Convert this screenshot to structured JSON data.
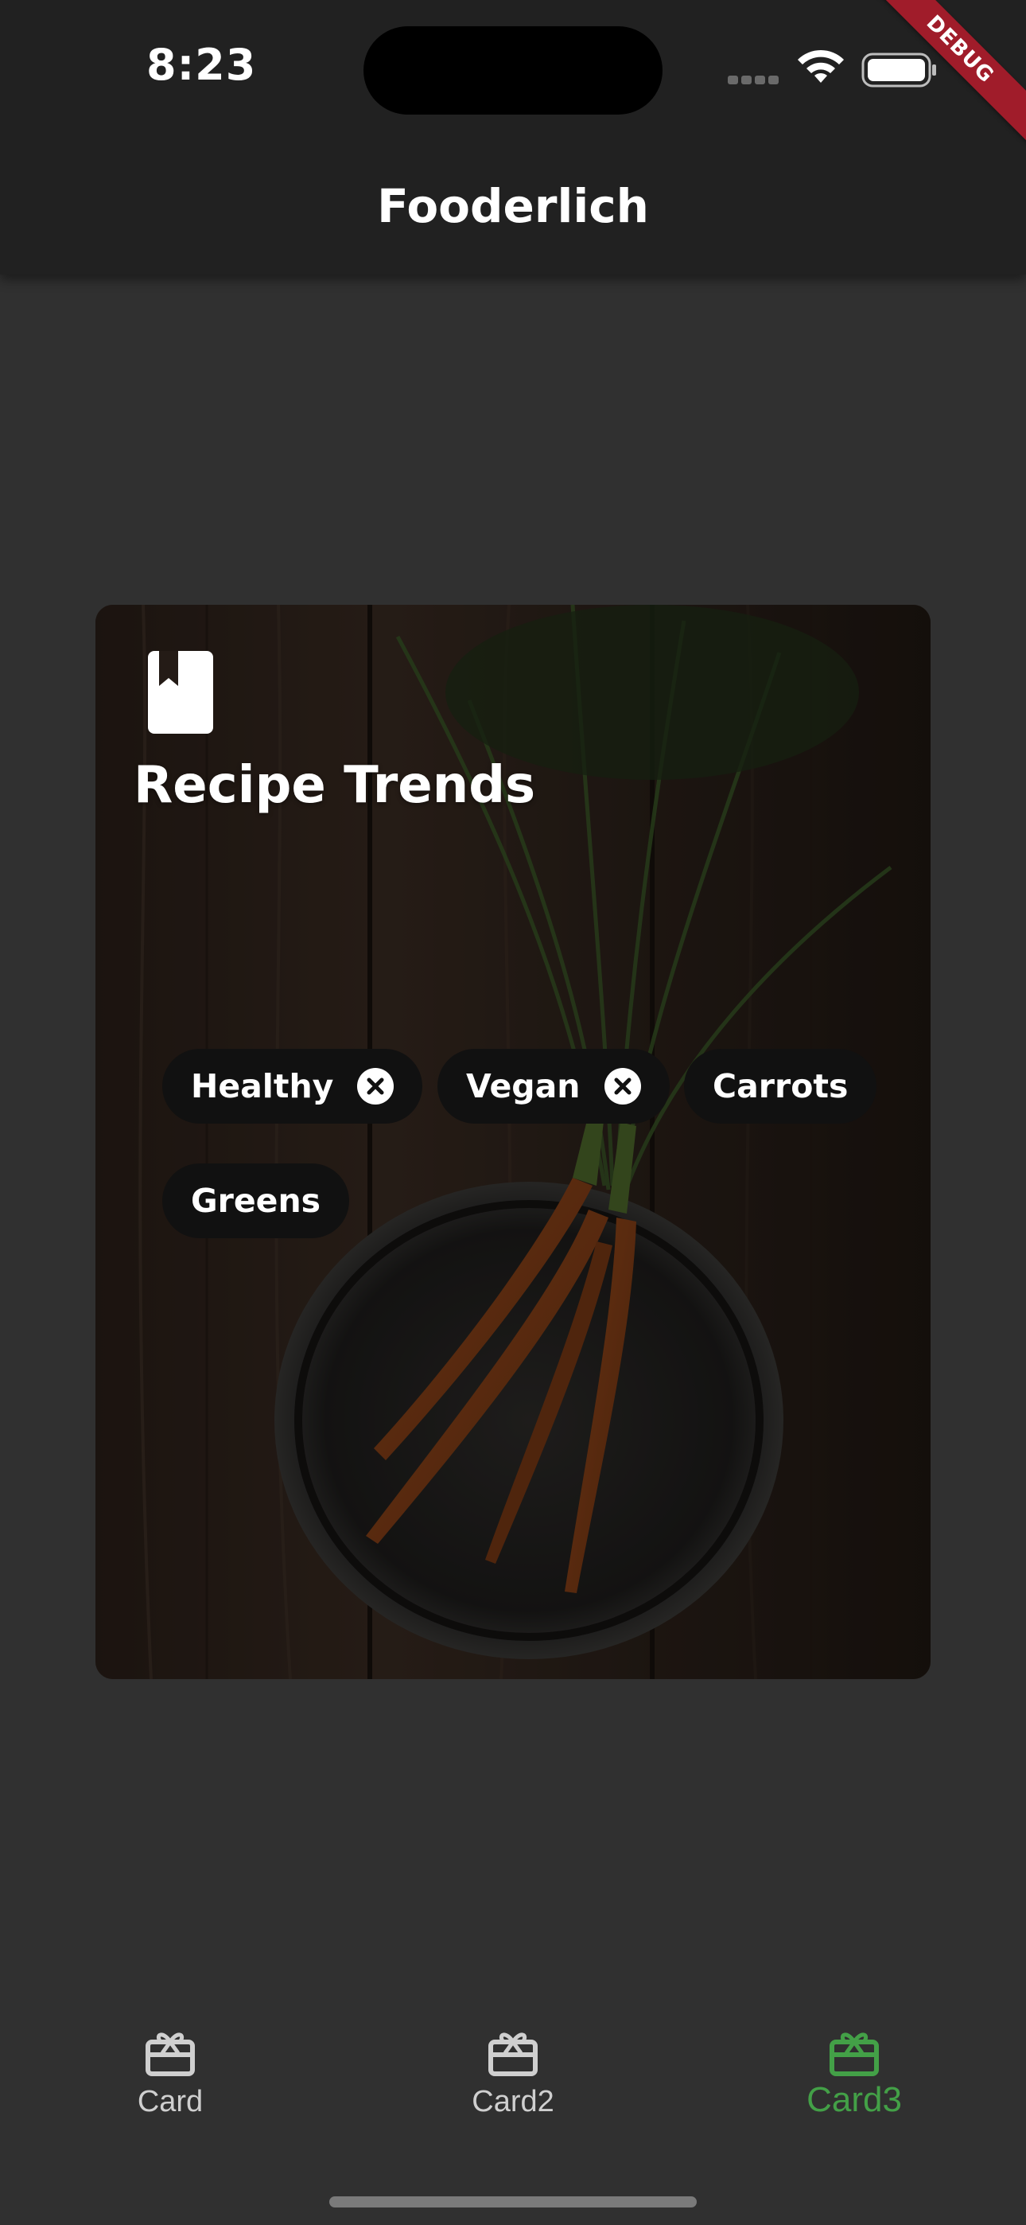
{
  "status_bar": {
    "time": "8:23",
    "debug_banner": "DEBUG"
  },
  "app_bar": {
    "title": "Fooderlich"
  },
  "card": {
    "icon": "book-icon",
    "title": "Recipe Trends",
    "chips": [
      {
        "label": "Healthy",
        "removable": true
      },
      {
        "label": "Vegan",
        "removable": true
      },
      {
        "label": "Carrots",
        "removable": false
      },
      {
        "label": "Greens",
        "removable": false
      }
    ]
  },
  "bottom_nav": {
    "items": [
      {
        "label": "Card",
        "icon": "card-giftcard-icon",
        "selected": false
      },
      {
        "label": "Card2",
        "icon": "card-giftcard-icon",
        "selected": false
      },
      {
        "label": "Card3",
        "icon": "card-giftcard-icon",
        "selected": true
      }
    ]
  },
  "colors": {
    "background": "#303030",
    "app_bar": "#212121",
    "accent": "#43a047",
    "chip": "#111111",
    "debug_banner": "#a01c2a"
  }
}
